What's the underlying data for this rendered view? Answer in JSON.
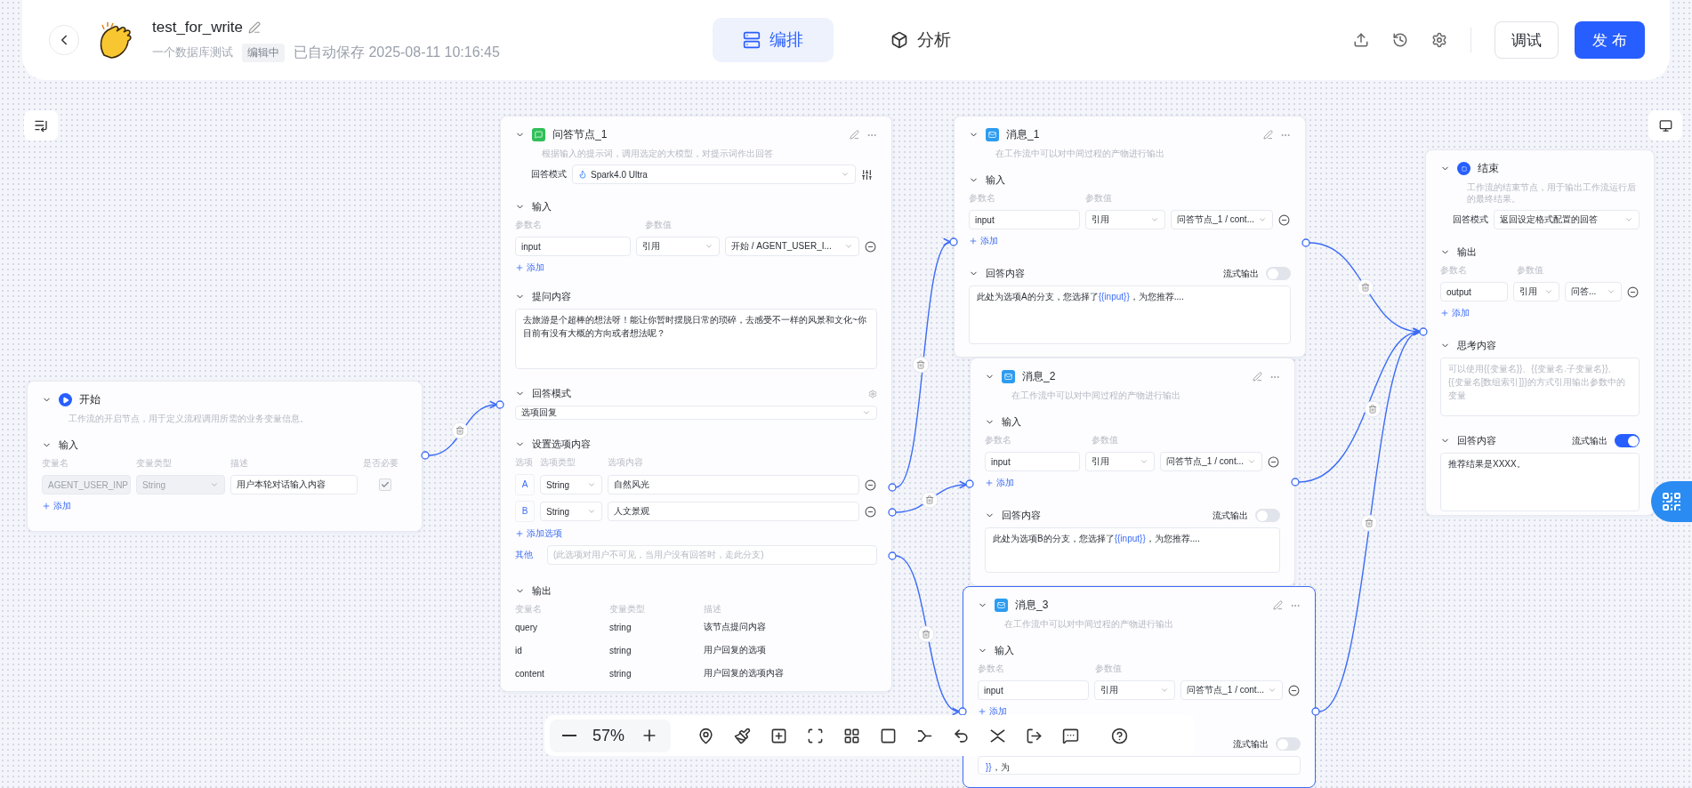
{
  "header": {
    "title": "test_for_write",
    "subtitle": "一个数据库测试",
    "status": "编辑中",
    "autosave": "已自动保存 2025-08-11 10:16:45",
    "tabs": [
      {
        "label": "编排",
        "kind": "orchestrate",
        "selected": true
      },
      {
        "label": "分析",
        "kind": "analyze",
        "selected": false
      }
    ],
    "debug_button": "调试",
    "publish_button": "发 布"
  },
  "start_node": {
    "title": "开始",
    "description": "工作流的开启节点，用于定义流程调用所需的业务变量信息。",
    "section": "输入",
    "columns": [
      "变量名",
      "变量类型",
      "描述",
      "是否必要"
    ],
    "rows": [
      {
        "name": "AGENT_USER_INP",
        "type": "String",
        "description": "用户本轮对话输入内容",
        "required": true,
        "disabled": true
      }
    ],
    "add_label": "添加"
  },
  "qa_node": {
    "title": "问答节点_1",
    "description": "根据输入的提示词，调用选定的大模型，对提示词作出回答",
    "model_label": "回答模式",
    "model": "Spark4.0 Ultra",
    "input": {
      "title": "输入",
      "columns": [
        "参数名",
        "参数值"
      ],
      "rows": [
        {
          "name": "input",
          "mode": "引用",
          "value": "开始 / AGENT_USER_I..."
        }
      ],
      "add_label": "添加"
    },
    "prompt": {
      "title": "提问内容",
      "text": "去旅游是个超棒的想法呀！能让你暂时摆脱日常的琐碎，去感受不一样的风景和文化~你目前有没有大概的方向或者想法呢？"
    },
    "answer_mode": {
      "title": "回答模式",
      "value": "选项回复"
    },
    "options": {
      "title": "设置选项内容",
      "columns": [
        "选项",
        "选项类型",
        "选项内容"
      ],
      "rows": [
        {
          "key": "A",
          "type": "String",
          "content": "自然风光"
        },
        {
          "key": "B",
          "type": "String",
          "content": "人文景观"
        }
      ],
      "add_label": "添加选项",
      "other_label": "其他",
      "other_placeholder": "(此选项对用户不可见，当用户没有回答时，走此分支)"
    },
    "output": {
      "title": "输出",
      "columns": [
        "变量名",
        "变量类型",
        "描述"
      ],
      "rows": [
        {
          "name": "query",
          "type": "string",
          "description": "该节点提问内容"
        },
        {
          "name": "id",
          "type": "string",
          "description": "用户回复的选项"
        },
        {
          "name": "content",
          "type": "string",
          "description": "用户回复的选项内容"
        }
      ]
    }
  },
  "message_nodes": [
    {
      "title": "消息_1",
      "description": "在工作流中可以对中间过程的产物进行输出",
      "selected": false,
      "input_title": "输入",
      "columns": [
        "参数名",
        "参数值"
      ],
      "rows": [
        {
          "name": "input",
          "mode": "引用",
          "value": "问答节点_1 / cont..."
        }
      ],
      "add_label": "添加",
      "answer_title": "回答内容",
      "stream_label": "流式输出",
      "stream_on": false,
      "answer": [
        {
          "text": "此处为选项A的分支，您选择了",
          "kind": "plain"
        },
        {
          "text": "{{input}}",
          "kind": "variable"
        },
        {
          "text": "，为您推荐....",
          "kind": "plain"
        }
      ]
    },
    {
      "title": "消息_2",
      "description": "在工作流中可以对中间过程的产物进行输出",
      "selected": false,
      "input_title": "输入",
      "columns": [
        "参数名",
        "参数值"
      ],
      "rows": [
        {
          "name": "input",
          "mode": "引用",
          "value": "问答节点_1 / cont..."
        }
      ],
      "add_label": "添加",
      "answer_title": "回答内容",
      "stream_label": "流式输出",
      "stream_on": false,
      "answer": [
        {
          "text": "此处为选项B的分支，您选择了",
          "kind": "plain"
        },
        {
          "text": "{{input}}",
          "kind": "variable"
        },
        {
          "text": "，为您推荐....",
          "kind": "plain"
        }
      ]
    },
    {
      "title": "消息_3",
      "description": "在工作流中可以对中间过程的产物进行输出",
      "selected": true,
      "input_title": "输入",
      "columns": [
        "参数名",
        "参数值"
      ],
      "rows": [
        {
          "name": "input",
          "mode": "引用",
          "value": "问答节点_1 / cont..."
        }
      ],
      "add_label": "添加",
      "stream_label": "流式输出",
      "stream_on": false,
      "answer": [
        {
          "text": "}}",
          "kind": "variable"
        },
        {
          "text": "，为",
          "kind": "plain"
        }
      ]
    }
  ],
  "end_node": {
    "title": "结束",
    "description": "工作流的结束节点，用于输出工作流运行后的最终结果。",
    "mode_label": "回答模式",
    "mode": "返回设定格式配置的回答",
    "output": {
      "title": "输出",
      "columns": [
        "参数名",
        "参数值"
      ],
      "rows": [
        {
          "name": "output",
          "mode": "引用",
          "value": "问答..."
        }
      ],
      "add_label": "添加"
    },
    "think": {
      "title": "思考内容",
      "placeholder": "可以使用{{变量名}}、{{变量名.子变量名}}、{{变量名[数组索引]}}的方式引用输出参数中的变量"
    },
    "answer": {
      "title": "回答内容",
      "stream_label": "流式输出",
      "stream_on": true,
      "text": "推荐结果是XXXX。"
    }
  },
  "toolbar": {
    "zoom": "57%"
  }
}
